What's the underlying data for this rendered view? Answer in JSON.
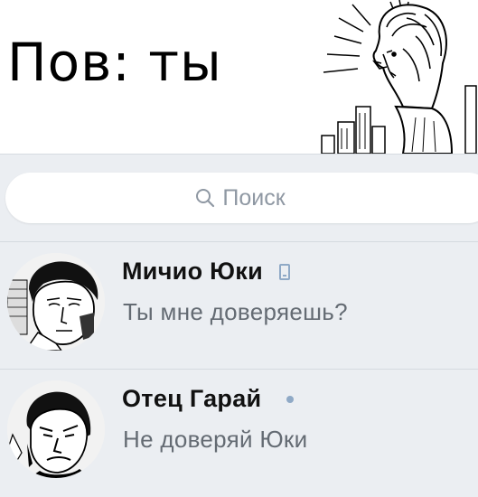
{
  "meme": {
    "title": "Пов: ты"
  },
  "search": {
    "placeholder": "Поиск",
    "icon": "search-icon"
  },
  "colors": {
    "background": "#ebeef2",
    "accent": "#8fa9c6",
    "name": "#111111",
    "message": "#646b73"
  },
  "chats": [
    {
      "name": "Мичио Юки",
      "message": "Ты мне доверяешь?",
      "status_icon": "mobile-phone-icon"
    },
    {
      "name": "Отец Гарай",
      "message": "Не доверяй Юки",
      "status_icon": "online-dot-icon"
    }
  ]
}
